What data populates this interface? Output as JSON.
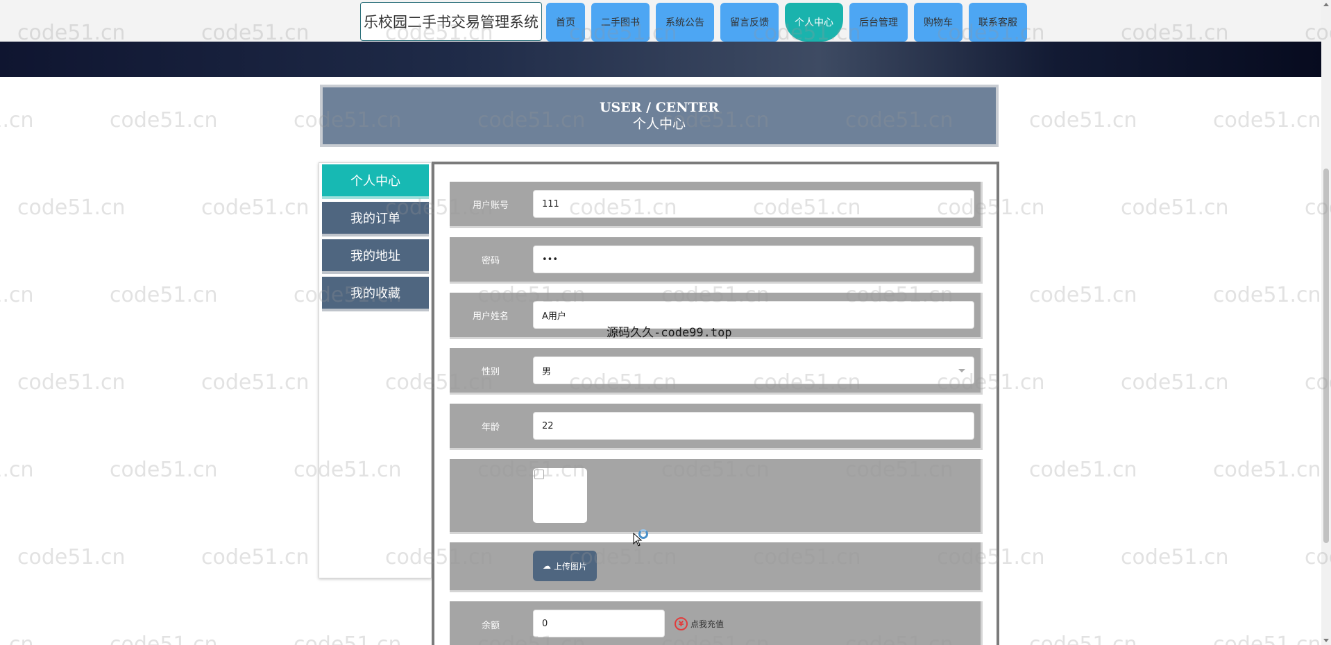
{
  "header": {
    "site_title": "乐校园二手书交易管理系统",
    "nav": [
      {
        "label": "首页",
        "active": false
      },
      {
        "label": "二手图书",
        "active": false
      },
      {
        "label": "系统公告",
        "active": false
      },
      {
        "label": "留言反馈",
        "active": false
      },
      {
        "label": "个人中心",
        "active": true
      },
      {
        "label": "后台管理",
        "active": false
      },
      {
        "label": "购物车",
        "active": false
      },
      {
        "label": "联系客服",
        "active": false
      }
    ]
  },
  "page_header": {
    "en": "USER / CENTER",
    "cn": "个人中心"
  },
  "sidebar": {
    "items": [
      {
        "label": "个人中心",
        "active": true
      },
      {
        "label": "我的订单",
        "active": false
      },
      {
        "label": "我的地址",
        "active": false
      },
      {
        "label": "我的收藏",
        "active": false
      }
    ]
  },
  "form": {
    "username": {
      "label": "用户账号",
      "value": "111"
    },
    "password": {
      "label": "密码",
      "value": "•••"
    },
    "realname": {
      "label": "用户姓名",
      "value": "A用户"
    },
    "gender": {
      "label": "性别",
      "value": "男"
    },
    "age": {
      "label": "年龄",
      "value": "22"
    },
    "upload": {
      "label": "上传图片"
    },
    "balance": {
      "label": "余额",
      "value": "0",
      "recharge_label": "点我充值",
      "yen_symbol": "¥"
    }
  },
  "overlay": {
    "source_note": "源码久久-code99.top"
  },
  "watermark": {
    "text": "code51.cn"
  },
  "colors": {
    "nav_blue": "#4da6f3",
    "active_teal": "#1ab3ad",
    "menu_slate": "#4f6680",
    "row_gray": "#a5a5a5"
  }
}
